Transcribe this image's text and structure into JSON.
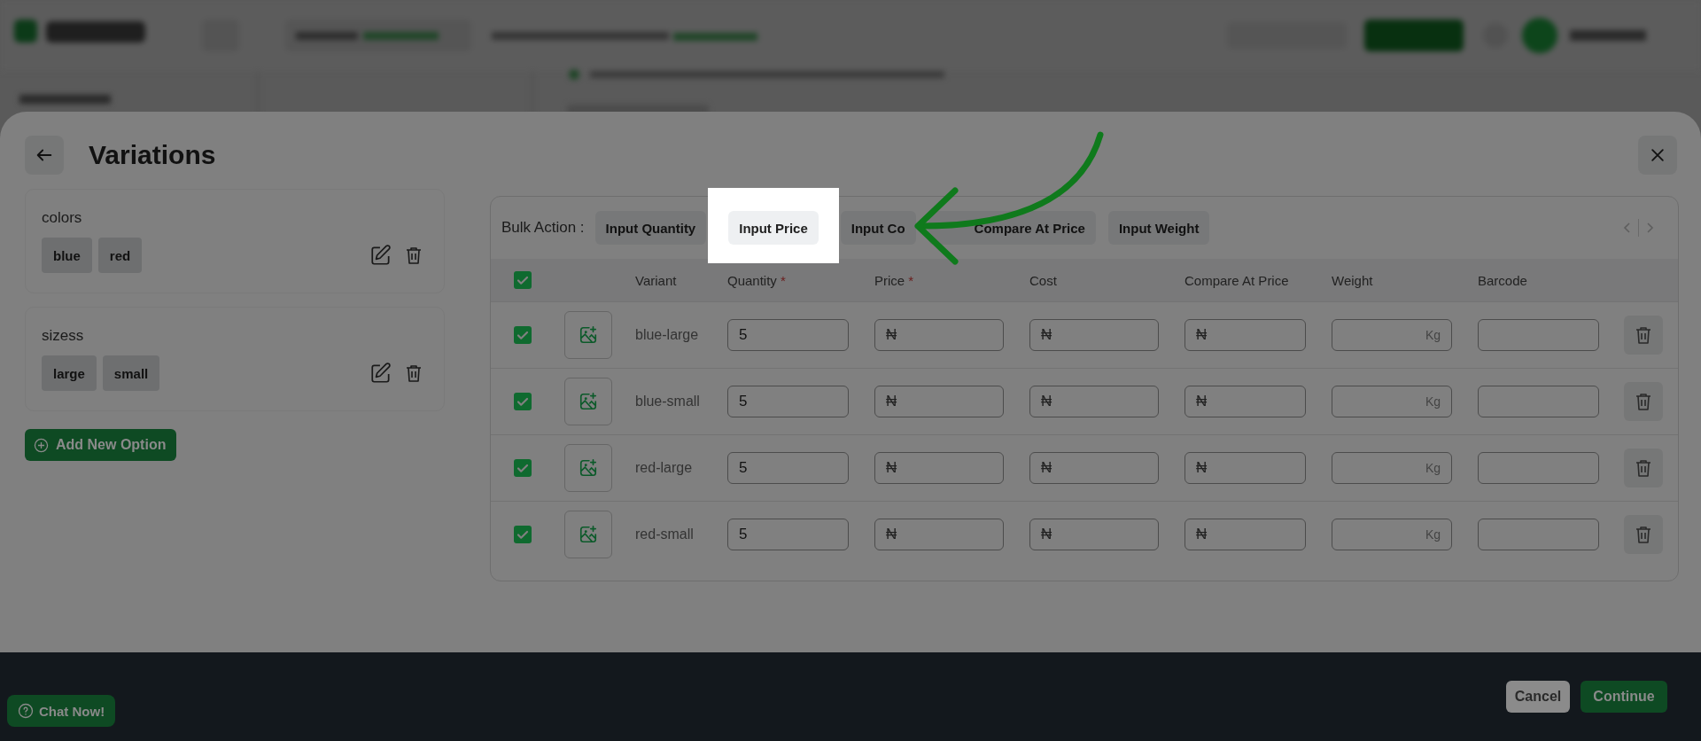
{
  "modal": {
    "title": "Variations"
  },
  "options": [
    {
      "name": "colors",
      "values": [
        "blue",
        "red"
      ]
    },
    {
      "name": "sizess",
      "values": [
        "large",
        "small"
      ]
    }
  ],
  "add_option_button": "Add New Option",
  "bulk_action": {
    "label": "Bulk Action :",
    "actions": [
      {
        "label": "Input Quantity",
        "highlighted": false
      },
      {
        "label": "Input Price",
        "highlighted": true
      },
      {
        "label": "Input Co",
        "highlighted": false
      },
      {
        "label": "Compare At Price",
        "highlighted": false
      },
      {
        "label": "Input Weight",
        "highlighted": false
      }
    ]
  },
  "table": {
    "header_checked": true,
    "columns": [
      {
        "label": "Variant"
      },
      {
        "label": "Quantity",
        "required_mark": "*"
      },
      {
        "label": "Price",
        "required_mark": "*"
      },
      {
        "label": "Cost"
      },
      {
        "label": "Compare At Price"
      },
      {
        "label": "Weight"
      },
      {
        "label": "Barcode"
      }
    ],
    "rows": [
      {
        "checked": true,
        "variant": "blue-large",
        "quantity": "5",
        "price_prefix": "₦",
        "cost_prefix": "₦",
        "compare_at_price_prefix": "₦",
        "weight_unit": "Kg"
      },
      {
        "checked": true,
        "variant": "blue-small",
        "quantity": "5",
        "price_prefix": "₦",
        "cost_prefix": "₦",
        "compare_at_price_prefix": "₦",
        "weight_unit": "Kg"
      },
      {
        "checked": true,
        "variant": "red-large",
        "quantity": "5",
        "price_prefix": "₦",
        "cost_prefix": "₦",
        "compare_at_price_prefix": "₦",
        "weight_unit": "Kg"
      },
      {
        "checked": true,
        "variant": "red-small",
        "quantity": "5",
        "price_prefix": "₦",
        "cost_prefix": "₦",
        "compare_at_price_prefix": "₦",
        "weight_unit": "Kg"
      }
    ]
  },
  "footer": {
    "cancel": "Cancel",
    "continue": "Continue"
  },
  "chat_button": "Chat Now!"
}
